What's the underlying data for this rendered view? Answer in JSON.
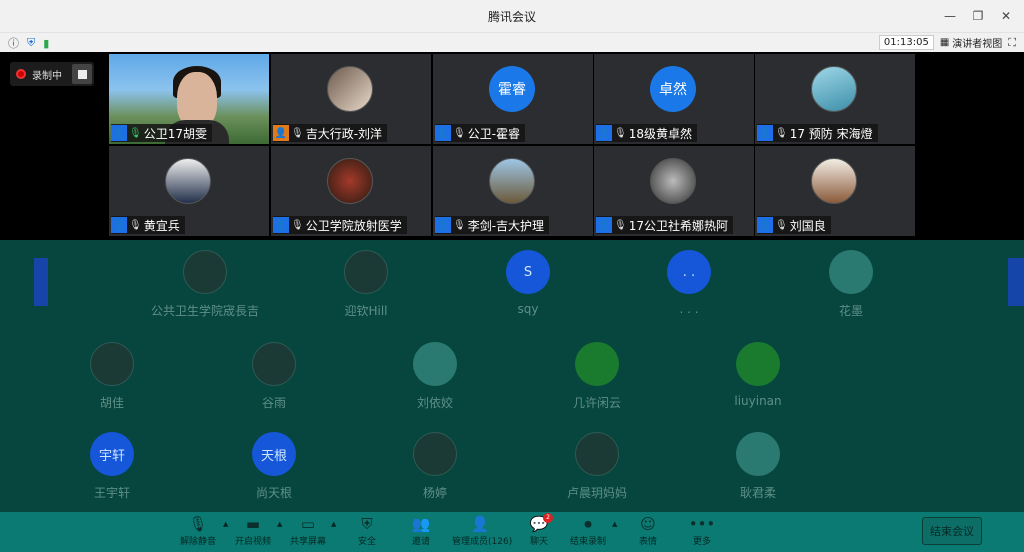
{
  "window": {
    "title": "腾讯会议"
  },
  "statusbar": {
    "timer": "01:13:05",
    "view_label": "演讲者视图"
  },
  "recording": {
    "label": "录制中"
  },
  "tiles": [
    {
      "name": "公卫17胡雯",
      "mic": "on"
    },
    {
      "name": "吉大行政-刘洋",
      "mic": "muted"
    },
    {
      "name": "公卫-霍睿",
      "mic": "muted",
      "avatar_text": "霍睿"
    },
    {
      "name": "18级黄卓然",
      "mic": "muted",
      "avatar_text": "卓然"
    },
    {
      "name": "17 预防 宋海燈",
      "mic": "muted"
    },
    {
      "name": "黄宜兵",
      "mic": "muted"
    },
    {
      "name": "公卫学院放射医学",
      "mic": "muted"
    },
    {
      "name": "李剑-吉大护理",
      "mic": "muted"
    },
    {
      "name": "17公卫社希娜热阿",
      "mic": "muted"
    },
    {
      "name": "刘国良",
      "mic": "muted"
    }
  ],
  "gallery": [
    {
      "name": "公共卫生学院宬長吉",
      "avatar_text": ""
    },
    {
      "name": "迎钦Hill",
      "avatar_text": ""
    },
    {
      "name": "sqy",
      "avatar_text": "S"
    },
    {
      "name": ". . .",
      "avatar_text": ". ."
    },
    {
      "name": "花墨",
      "avatar_text": ""
    },
    {
      "name": "胡佳",
      "avatar_text": ""
    },
    {
      "name": "谷雨",
      "avatar_text": ""
    },
    {
      "name": "刘依姣",
      "avatar_text": ""
    },
    {
      "name": "几许闲云",
      "avatar_text": ""
    },
    {
      "name": "liuyinan",
      "avatar_text": ""
    },
    {
      "name": "王宇轩",
      "avatar_text": "宇轩"
    },
    {
      "name": "尚天根",
      "avatar_text": "天根"
    },
    {
      "name": "杨婷",
      "avatar_text": ""
    },
    {
      "name": "卢晨玥妈妈",
      "avatar_text": ""
    },
    {
      "name": "耿君柔",
      "avatar_text": ""
    }
  ],
  "toolbar": {
    "unmute": "解除静音",
    "video": "开启视频",
    "share": "共享屏幕",
    "security": "安全",
    "invite": "邀请",
    "members": "管理成员(126)",
    "chat": "聊天",
    "end_record": "结束录制",
    "reactions": "表情",
    "more": "更多",
    "end_meeting": "结束会议",
    "chat_badge": "2"
  }
}
